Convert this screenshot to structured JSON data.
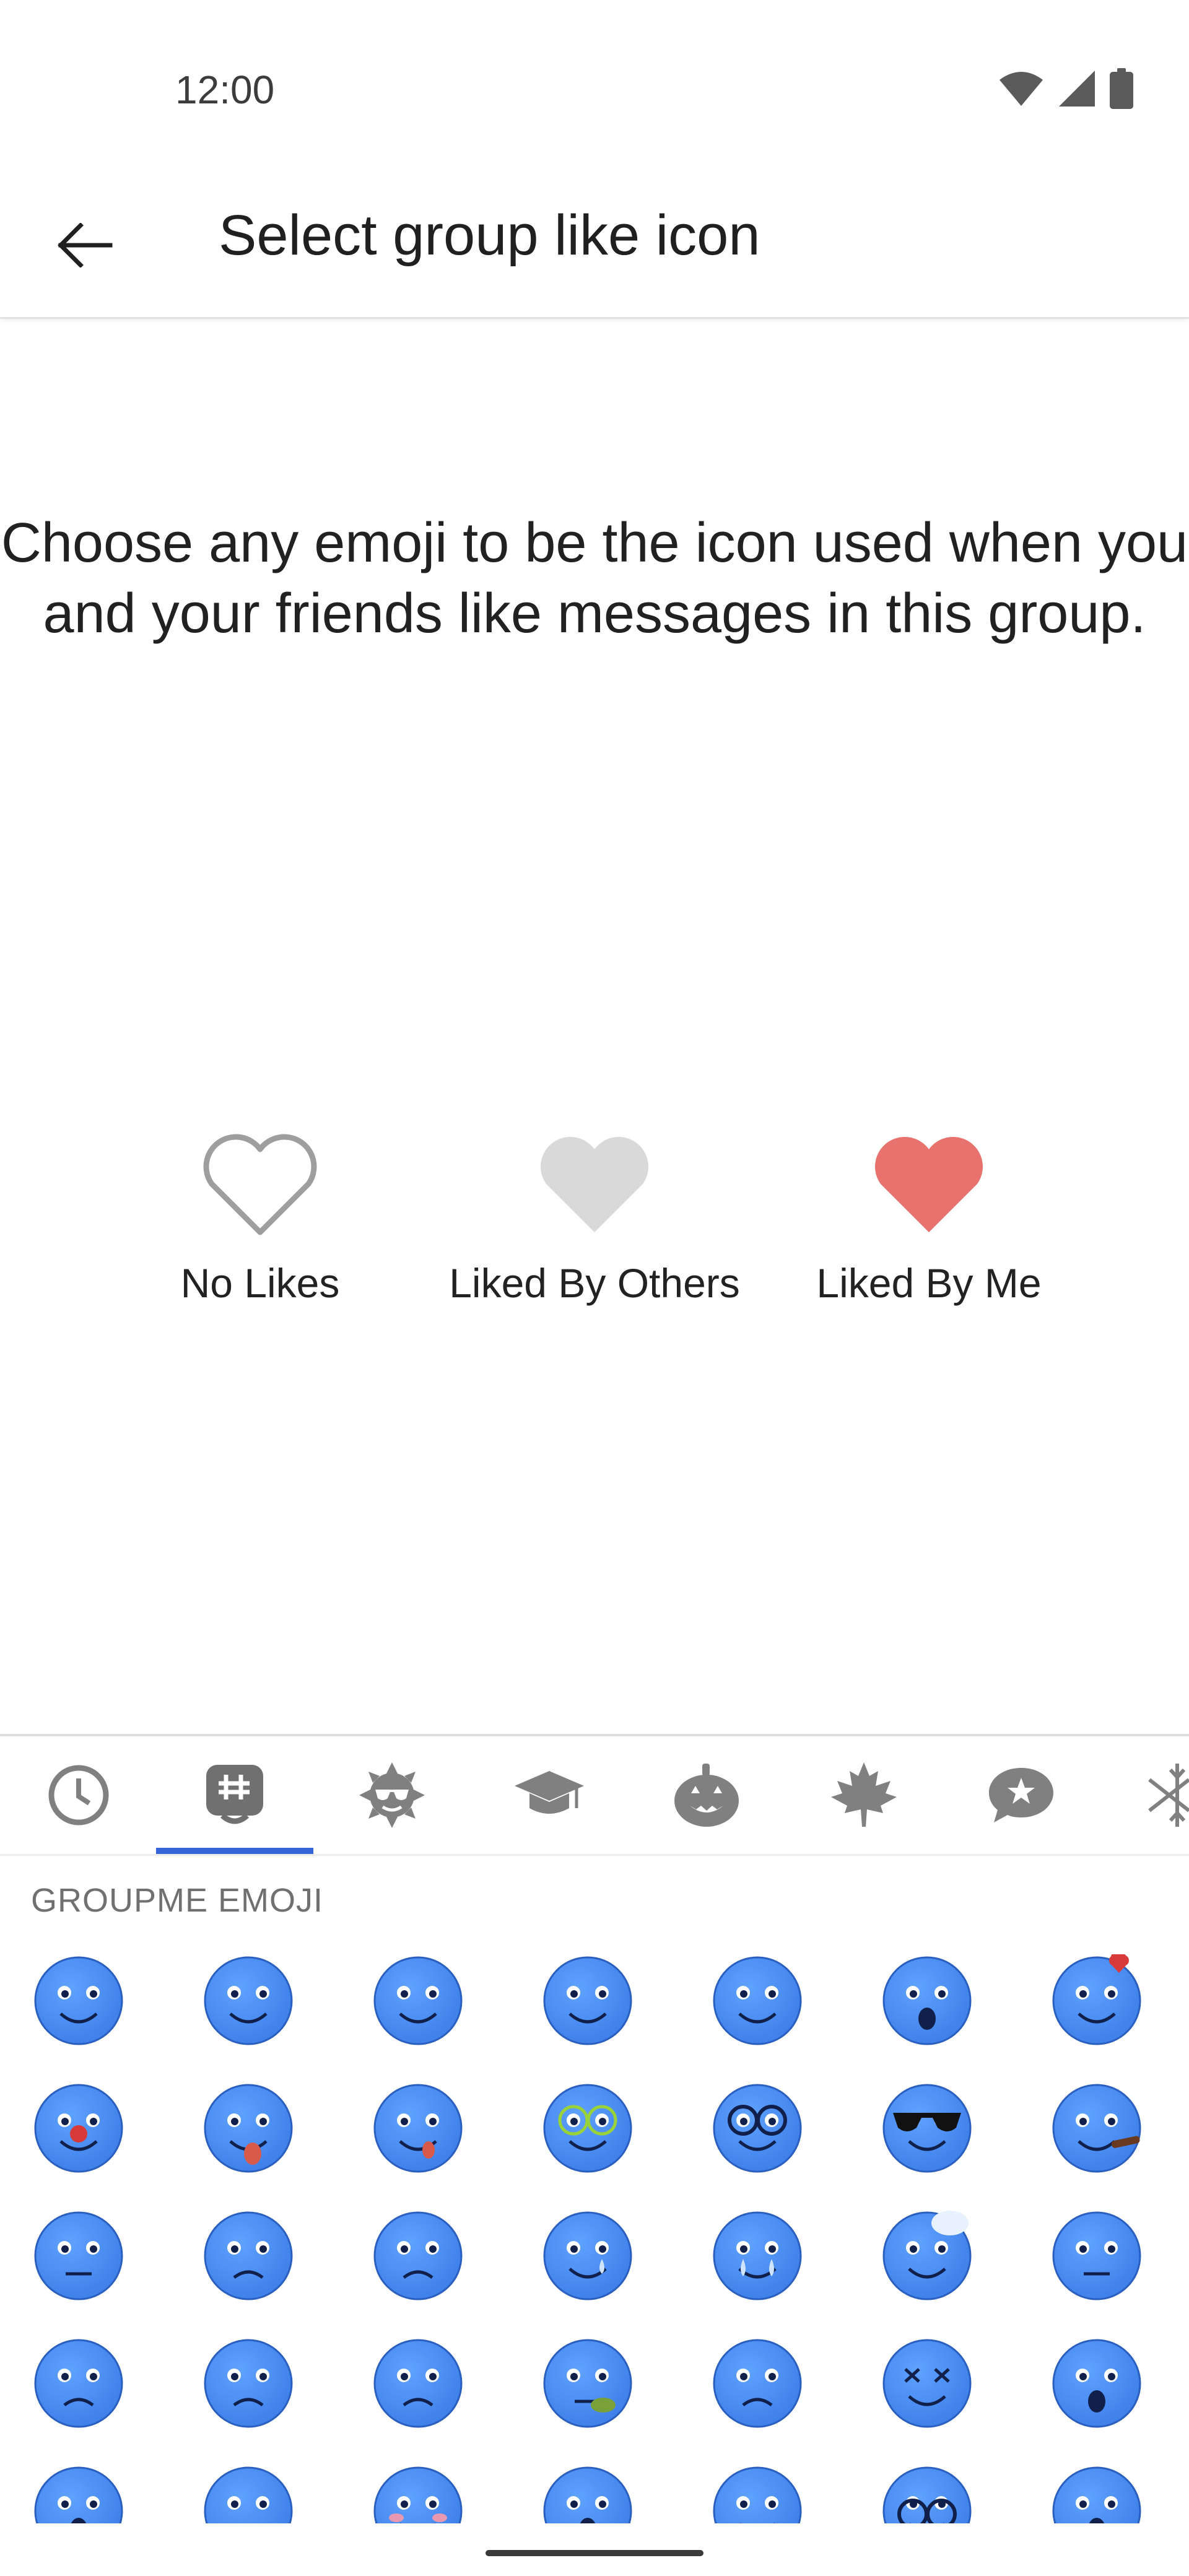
{
  "status_bar": {
    "time": "12:00",
    "icons": [
      "wifi-icon",
      "signal-icon",
      "battery-icon"
    ]
  },
  "app_bar": {
    "back_icon": "arrow-back-icon",
    "title": "Select group like icon"
  },
  "description": "Choose any emoji to be the icon used when you and your friends like messages in this group.",
  "like_states": [
    {
      "label": "No Likes",
      "icon": "heart-outline-icon",
      "color": "#b0b0b0"
    },
    {
      "label": "Liked By Others",
      "icon": "heart-filled-gray-icon",
      "color": "#d9d9d9"
    },
    {
      "label": "Liked By Me",
      "icon": "heart-filled-red-icon",
      "color": "#e8736e"
    }
  ],
  "emoji_tabs": [
    {
      "name": "recent",
      "icon": "clock-icon",
      "selected": false
    },
    {
      "name": "groupme",
      "icon": "groupme-icon",
      "selected": true
    },
    {
      "name": "summer",
      "icon": "sun-sunglasses-icon",
      "selected": false
    },
    {
      "name": "school",
      "icon": "graduation-cap-icon",
      "selected": false
    },
    {
      "name": "halloween",
      "icon": "pumpkin-icon",
      "selected": false
    },
    {
      "name": "autumn",
      "icon": "maple-leaf-icon",
      "selected": false
    },
    {
      "name": "stickers",
      "icon": "star-bubble-icon",
      "selected": false
    },
    {
      "name": "winter",
      "icon": "snowflake-icon",
      "selected": false
    }
  ],
  "section_header": "GROUPME EMOJI",
  "emojis": [
    "smile",
    "grin",
    "happy",
    "content",
    "wink",
    "surprised",
    "love",
    "clown-nose",
    "tongue-out",
    "silly-tongue",
    "nerd-green-glasses",
    "nerd-glasses",
    "sunglasses",
    "cigar",
    "neutral",
    "sad",
    "worried",
    "tear",
    "crying",
    "sweating",
    "unamused",
    "angry",
    "confused",
    "skeptical",
    "queasy",
    "sick",
    "dizzy",
    "shocked",
    "staring",
    "frown",
    "blushing",
    "wide-eyed",
    "kiss",
    "glasses-down",
    "cold"
  ],
  "colors": {
    "accent": "#3565d6",
    "emoji_face": "#3d7ee8",
    "heart_red": "#e8736e",
    "heart_gray": "#d9d9d9"
  }
}
